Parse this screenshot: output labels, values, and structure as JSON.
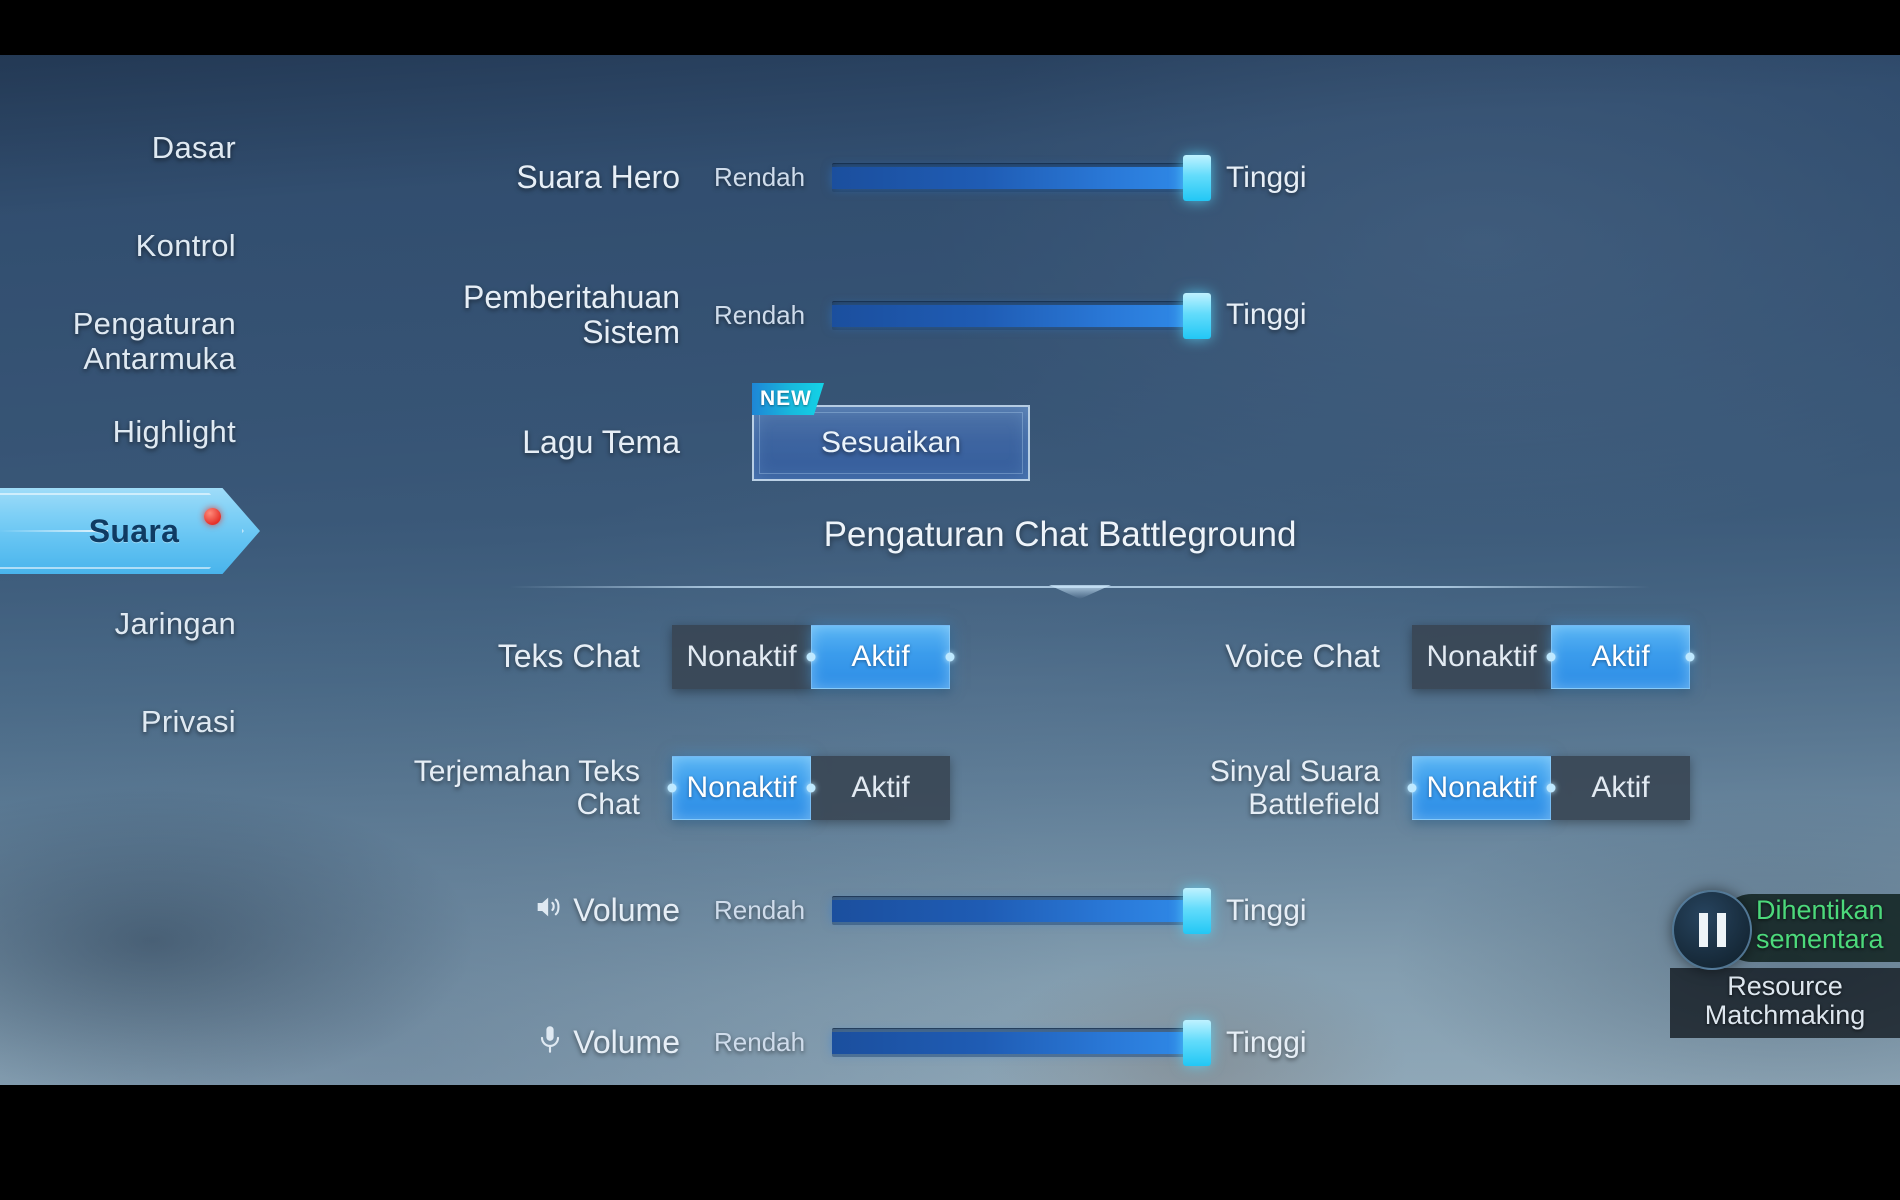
{
  "app": {
    "screen_title": "Pengaturan Chat Battleground"
  },
  "sidebar": {
    "items": [
      {
        "label": "Dasar",
        "selected": false
      },
      {
        "label": "Kontrol",
        "selected": false
      },
      {
        "label_line1": "Pengaturan",
        "label_line2": "Antarmuka",
        "selected": false
      },
      {
        "label": "Highlight",
        "selected": false
      },
      {
        "label": "Suara",
        "selected": true,
        "badge": "new-dot"
      },
      {
        "label": "Jaringan",
        "selected": false
      },
      {
        "label": "Privasi",
        "selected": false
      }
    ]
  },
  "sliders": {
    "hero_voice": {
      "label": "Suara Hero",
      "min_label": "Rendah",
      "max_label": "Tinggi",
      "value": 100
    },
    "system_notification": {
      "label_line1": "Pemberitahuan",
      "label_line2": "Sistem",
      "min_label": "Rendah",
      "max_label": "Tinggi",
      "value": 100
    },
    "speaker_volume": {
      "icon": "speaker-icon",
      "label": "Volume",
      "min_label": "Rendah",
      "max_label": "Tinggi",
      "value": 100
    },
    "mic_volume": {
      "icon": "microphone-icon",
      "label": "Volume",
      "min_label": "Rendah",
      "max_label": "Tinggi",
      "value": 100
    }
  },
  "theme_song": {
    "label": "Lagu Tema",
    "button_label": "Sesuaikan",
    "badge": "NEW"
  },
  "toggles": [
    {
      "label": "Teks Chat",
      "off_label": "Nonaktif",
      "on_label": "Aktif",
      "selected": "Aktif"
    },
    {
      "label": "Voice Chat",
      "off_label": "Nonaktif",
      "on_label": "Aktif",
      "selected": "Aktif"
    },
    {
      "label_line1": "Terjemahan Teks",
      "label_line2": "Chat",
      "off_label": "Nonaktif",
      "on_label": "Aktif",
      "selected": "Nonaktif"
    },
    {
      "label_line1": "Sinyal Suara",
      "label_line2": "Battlefield",
      "off_label": "Nonaktif",
      "on_label": "Aktif",
      "selected": "Nonaktif"
    }
  ],
  "overlay": {
    "status_line1": "Dihentikan",
    "status_line2": "sementara",
    "caption_line1": "Resource",
    "caption_line2": "Matchmaking",
    "icon": "pause-icon",
    "status_color": "#4cd97b"
  },
  "colors": {
    "accent_blue": "#2d8de6",
    "knob_cyan": "#22c7f5",
    "tab_cyan": "#63c3f2",
    "badge_red": "#e5322a",
    "toggle_off_bg": "#384452"
  }
}
